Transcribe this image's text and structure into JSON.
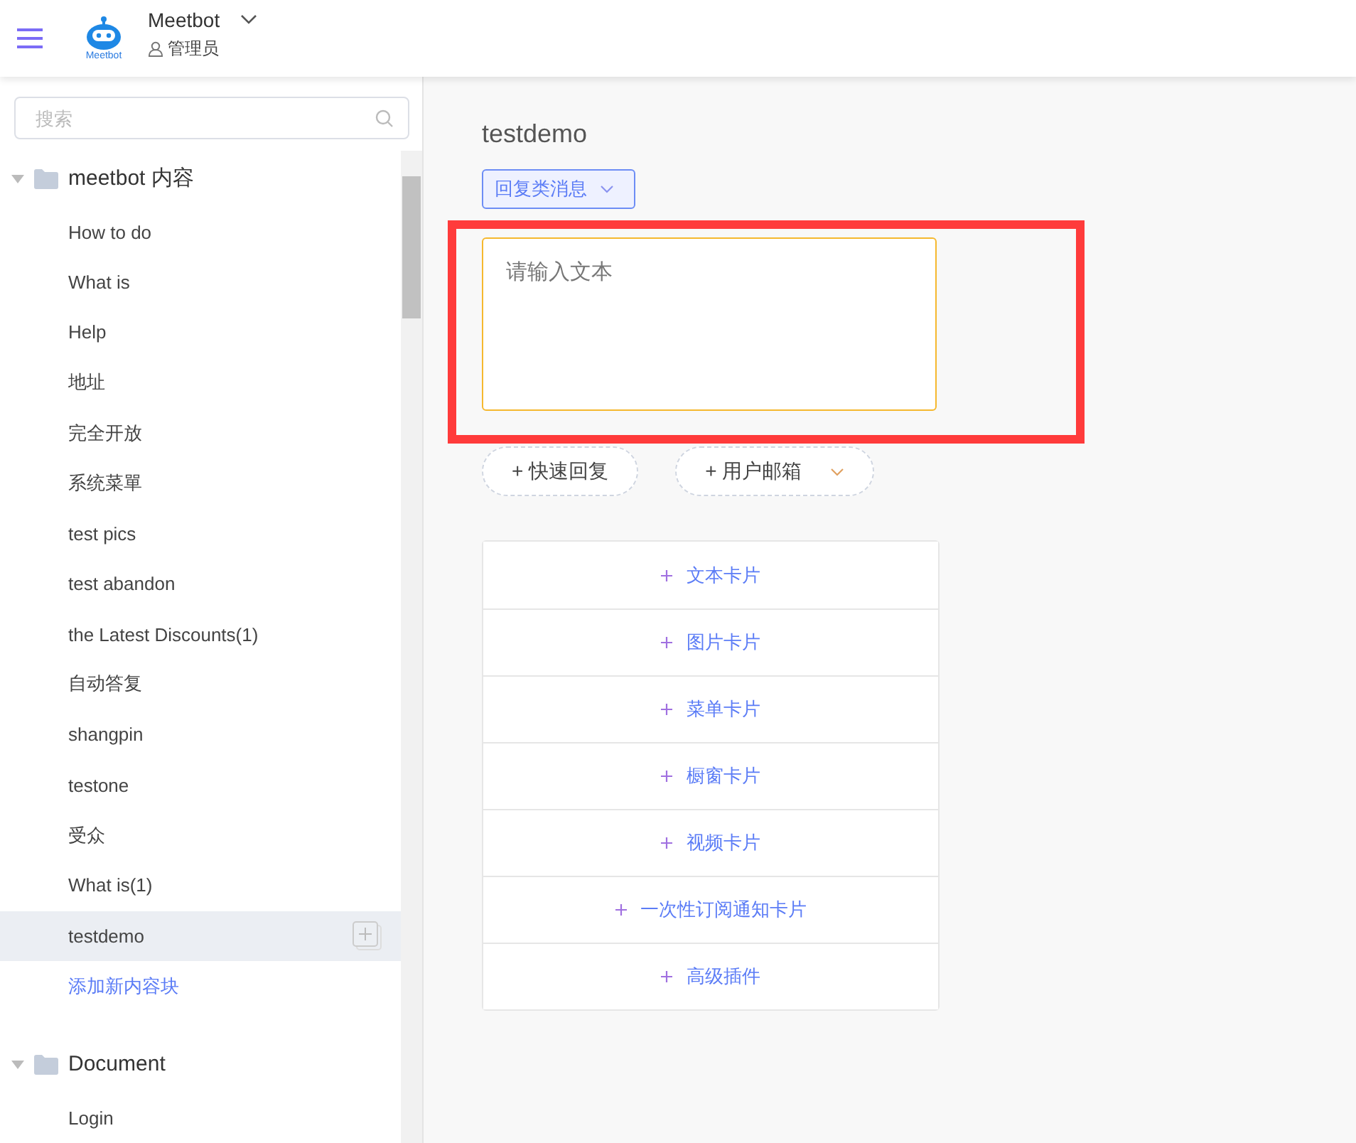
{
  "header": {
    "app_name": "Meetbot",
    "logo_text": "Meetbot",
    "role": "管理员"
  },
  "sidebar": {
    "search": {
      "placeholder": "搜索"
    },
    "groups": [
      {
        "label": "meetbot 内容",
        "expanded": true,
        "children": [
          {
            "label": "How to do",
            "selected": false
          },
          {
            "label": "What is",
            "selected": false
          },
          {
            "label": "Help",
            "selected": false
          },
          {
            "label": "地址",
            "selected": false
          },
          {
            "label": "完全开放",
            "selected": false
          },
          {
            "label": "系统菜單",
            "selected": false
          },
          {
            "label": "test pics",
            "selected": false
          },
          {
            "label": "test abandon",
            "selected": false
          },
          {
            "label": "the Latest Discounts(1)",
            "selected": false
          },
          {
            "label": "自动答复",
            "selected": false
          },
          {
            "label": "shangpin",
            "selected": false
          },
          {
            "label": "testone",
            "selected": false
          },
          {
            "label": "受众",
            "selected": false
          },
          {
            "label": "What is(1)",
            "selected": false
          },
          {
            "label": "testdemo",
            "selected": true
          }
        ],
        "add_link": "添加新内容块"
      },
      {
        "label": "Document",
        "expanded": true,
        "children": [
          {
            "label": "Login",
            "selected": false
          }
        ]
      }
    ]
  },
  "main": {
    "title": "testdemo",
    "message_type": "回复类消息",
    "text_input": {
      "placeholder": "请输入文本"
    },
    "highlight": true,
    "quick_buttons": [
      {
        "label": "+ 快速回复",
        "kind": "plain"
      },
      {
        "label": "+ 用户邮箱",
        "kind": "dropdown"
      }
    ],
    "card_options": [
      "文本卡片",
      "图片卡片",
      "菜单卡片",
      "橱窗卡片",
      "视频卡片",
      "一次性订阅通知卡片",
      "高级插件"
    ]
  }
}
